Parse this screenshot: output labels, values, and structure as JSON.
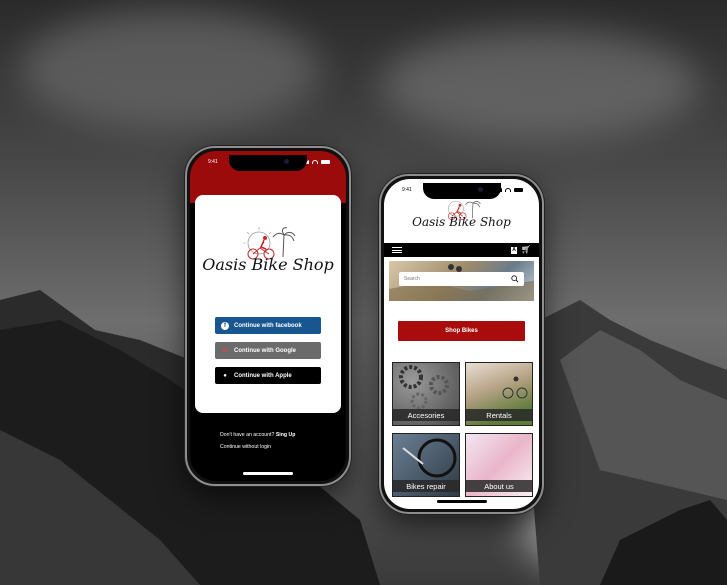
{
  "phone1": {
    "status_time": "9:41",
    "brand": "Oasis Bike Shop",
    "buttons": {
      "facebook": "Continue with facebook",
      "google": "Continue with Google",
      "apple": "Continue with Apple"
    },
    "no_account": "Don't have an account?",
    "sign_up": "Sing Up",
    "without_login": "Continue without login"
  },
  "phone2": {
    "status_time": "9:41",
    "brand": "Oasis Bike Shop",
    "search_placeholder": "Search",
    "az_label": "A",
    "shop_button": "Shop Bikes",
    "tiles": [
      "Accesories",
      "Rentals",
      "Bikes repair",
      "About us"
    ]
  },
  "colors": {
    "brand_red": "#9b0b0b",
    "facebook_blue": "#17568f",
    "google_grey": "#6b6b6b",
    "apple_black": "#000000"
  },
  "icons": [
    "facebook-icon",
    "google-icon",
    "apple-icon",
    "menu-icon",
    "cart-icon",
    "search-icon",
    "bike-logo-icon"
  ]
}
